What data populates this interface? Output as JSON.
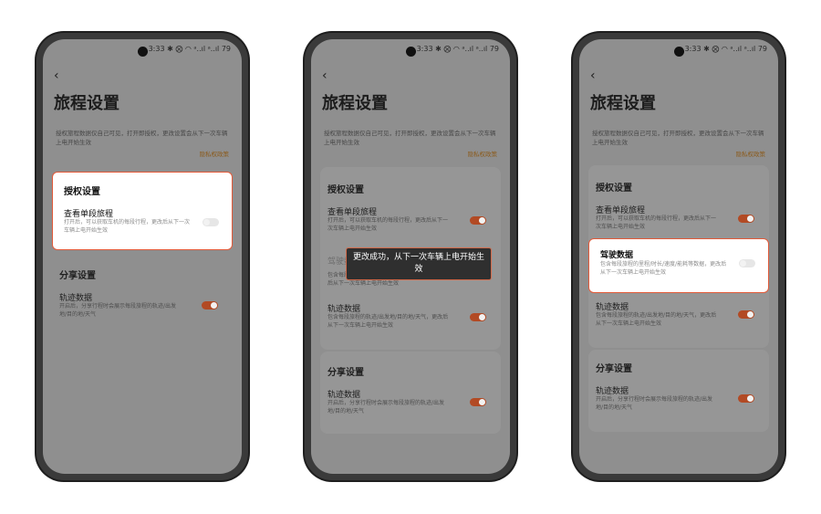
{
  "status": {
    "time": "3:33",
    "icons": "✱ ⨂ ◠ ᵃ..ıl ᵃ..ıl",
    "battery": "79"
  },
  "page_title": "旅程设置",
  "notice": "授权旅程数据仅自己可见，打开即授权，更改设置会从下一次车辆上电开始生效",
  "privacy_link": "隐私权政策",
  "auth_section": "授权设置",
  "single_trip": {
    "title": "查看单段旅程",
    "desc": "打开后，可以获取车机的每段行程，更改后从下一次车辆上电开始生效"
  },
  "driving_data": {
    "title": "驾驶数据",
    "desc": "包含每段旅程的里程/时长/速度/能耗等数据，更改后从下一次车辆上电开始生效"
  },
  "track_data_auth": {
    "title": "轨迹数据",
    "desc": "包含每段旅程的轨迹/出发地/目的地/天气，更改后从下一次车辆上电开始生效"
  },
  "share_section": "分享设置",
  "track_data_share": {
    "title": "轨迹数据",
    "desc": "开启后，分享行程时会展示每段旅程的轨迹/出发地/目的地/天气"
  },
  "toast": "更改成功，从下一次车辆上电开始生效"
}
